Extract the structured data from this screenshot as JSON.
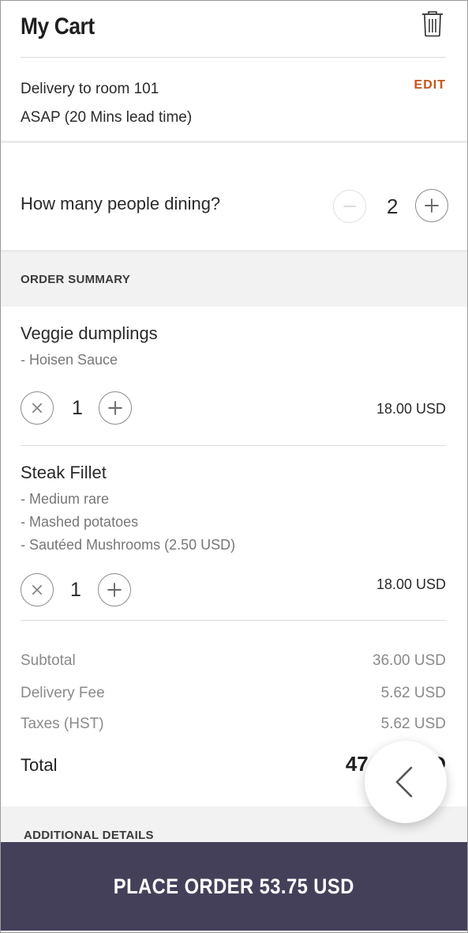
{
  "header": {
    "title": "My Cart",
    "trash_icon": "trash-icon"
  },
  "delivery": {
    "location": "Delivery to room 101",
    "time": "ASAP (20 Mins lead time)",
    "edit_label": "EDIT"
  },
  "dining": {
    "question": "How many people dining?",
    "count": "2"
  },
  "order_summary": {
    "heading": "ORDER SUMMARY",
    "items": [
      {
        "name": "Veggie dumplings",
        "options": [
          "- Hoisen Sauce"
        ],
        "quantity": "1",
        "price": "18.00 USD"
      },
      {
        "name": "Steak Fillet",
        "options": [
          "- Medium rare",
          "- Mashed potatoes",
          "- Sautéed Mushrooms (2.50 USD)"
        ],
        "quantity": "1",
        "price": "18.00 USD"
      }
    ]
  },
  "totals": {
    "subtotal_label": "Subtotal",
    "subtotal_value": "36.00 USD",
    "delivery_label": "Delivery Fee",
    "delivery_value": "5.62 USD",
    "taxes_label": "Taxes (HST)",
    "taxes_value": "5.62 USD",
    "total_label": "Total",
    "total_value": "47.75 USD"
  },
  "additional": {
    "heading": "ADDITIONAL DETAILS"
  },
  "footer": {
    "place_order_label": "PLACE ORDER 53.75 USD"
  },
  "colors": {
    "accent": "#c4551a",
    "footer_bg": "#45405a",
    "section_bg": "#f2f2f2"
  }
}
